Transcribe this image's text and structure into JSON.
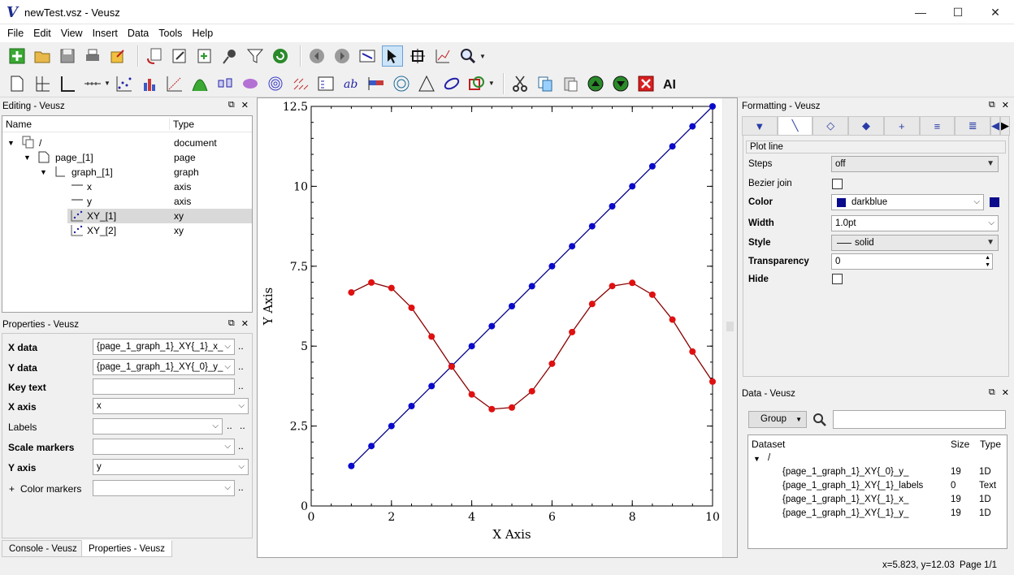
{
  "window": {
    "title": "newTest.vsz - Veusz",
    "app_icon": "V",
    "minimize": "—",
    "maximize": "☐",
    "close": "✕"
  },
  "menu": [
    "File",
    "Edit",
    "View",
    "Insert",
    "Data",
    "Tools",
    "Help"
  ],
  "editing": {
    "title": "Editing - Veusz",
    "col_name": "Name",
    "col_type": "Type",
    "rows": [
      {
        "name": "/",
        "type": "document"
      },
      {
        "name": "page_[1]",
        "type": "page"
      },
      {
        "name": "graph_[1]",
        "type": "graph"
      },
      {
        "name": "x",
        "type": "axis"
      },
      {
        "name": "y",
        "type": "axis"
      },
      {
        "name": "XY_[1]",
        "type": "xy"
      },
      {
        "name": "XY_[2]",
        "type": "xy"
      }
    ]
  },
  "properties": {
    "title": "Properties - Veusz",
    "rows": [
      {
        "label": "X data",
        "value": "{page_1_graph_1}_XY{_1}_x_"
      },
      {
        "label": "Y data",
        "value": "{page_1_graph_1}_XY{_0}_y_"
      },
      {
        "label": "Key text",
        "value": ""
      },
      {
        "label": "X axis",
        "value": "x"
      },
      {
        "label": "Labels",
        "value": ""
      },
      {
        "label": "Scale markers",
        "value": ""
      },
      {
        "label": "Y axis",
        "value": "y"
      },
      {
        "label": "Color markers",
        "value": ""
      }
    ],
    "expand_mark": "+",
    "dots": ".."
  },
  "bottom_tabs": [
    "Console - Veusz",
    "Properties - Veusz"
  ],
  "formatting": {
    "title": "Formatting - Veusz",
    "section": "Plot line",
    "rows": [
      {
        "label": "Steps",
        "value": "off"
      },
      {
        "label": "Bezier join",
        "value": ""
      },
      {
        "label": "Color",
        "value": "darkblue"
      },
      {
        "label": "Width",
        "value": "1.0pt"
      },
      {
        "label": "Style",
        "value": "solid"
      },
      {
        "label": "Transparency",
        "value": "0"
      },
      {
        "label": "Hide",
        "value": ""
      }
    ],
    "color_swatch": "#0a0a8c"
  },
  "data_panel": {
    "title": "Data - Veusz",
    "group_button": "Group",
    "col_dataset": "Dataset",
    "col_size": "Size",
    "col_type": "Type",
    "root": "/",
    "rows": [
      {
        "name": "{page_1_graph_1}_XY{_0}_y_",
        "size": "19",
        "type": "1D"
      },
      {
        "name": "{page_1_graph_1}_XY{_1}_labels",
        "size": "0",
        "type": "Text"
      },
      {
        "name": "{page_1_graph_1}_XY{_1}_x_",
        "size": "19",
        "type": "1D"
      },
      {
        "name": "{page_1_graph_1}_XY{_1}_y_",
        "size": "19",
        "type": "1D"
      }
    ]
  },
  "status": {
    "coords": "x=5.823, y=12.03",
    "page": "Page 1/1"
  },
  "chart_data": {
    "type": "line",
    "xlabel": "X Axis",
    "ylabel": "Y Axis",
    "xlim": [
      0,
      10
    ],
    "ylim": [
      0,
      12.5
    ],
    "xticks": [
      "0",
      "2",
      "4",
      "6",
      "8",
      "10"
    ],
    "yticks": [
      "0",
      "2.5",
      "5",
      "7.5",
      "10",
      "12.5"
    ],
    "x": [
      1,
      1.5,
      2,
      2.5,
      3,
      3.5,
      4,
      4.5,
      5,
      5.5,
      6,
      6.5,
      7,
      7.5,
      8,
      8.5,
      9,
      9.5,
      10
    ],
    "series": [
      {
        "color": "#0a0acc",
        "line_color": "#00008b",
        "values": [
          1.25,
          1.875,
          2.5,
          3.125,
          3.75,
          4.375,
          5.0,
          5.625,
          6.25,
          6.875,
          7.5,
          8.125,
          8.75,
          9.375,
          10.0,
          10.625,
          11.25,
          11.875,
          12.5
        ]
      },
      {
        "color": "#e01010",
        "line_color": "#8b0000",
        "values": [
          6.68,
          6.99,
          6.82,
          6.2,
          5.3,
          4.36,
          3.49,
          3.03,
          3.08,
          3.59,
          4.45,
          5.44,
          6.32,
          6.88,
          6.98,
          6.61,
          5.83,
          4.83,
          3.89
        ]
      }
    ]
  }
}
